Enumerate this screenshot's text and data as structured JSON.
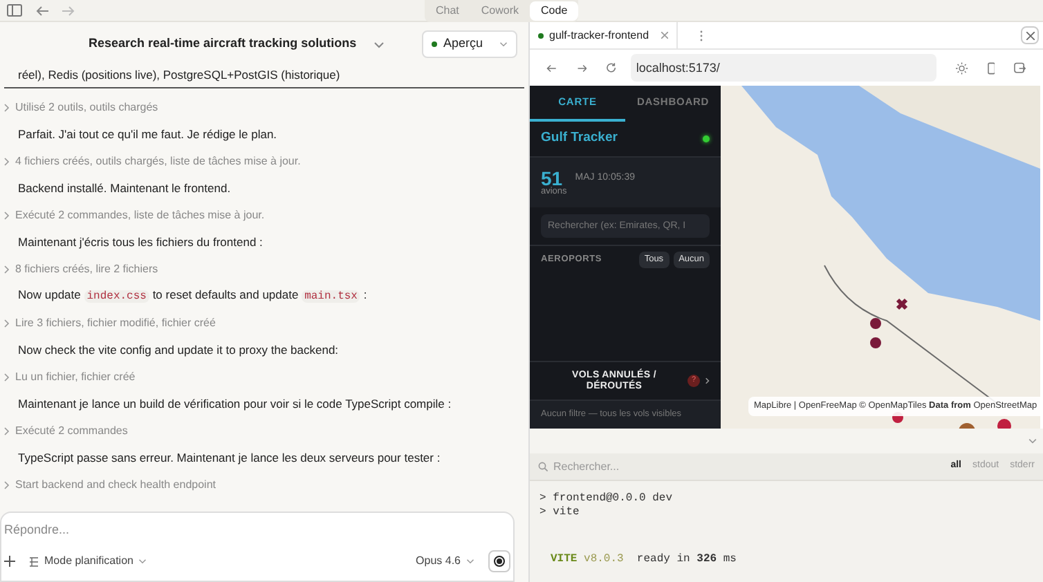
{
  "topbar": {
    "modes": [
      {
        "label": "Chat",
        "selected": false
      },
      {
        "label": "Cowork",
        "selected": false
      },
      {
        "label": "Code",
        "selected": true
      }
    ]
  },
  "chat": {
    "title": "Research real-time aircraft tracking solutions",
    "preview_button": "Aperçu",
    "messages": [
      {
        "kind": "tail",
        "parts": [
          {
            "kind": "plain",
            "text": "réel), Redis (positions live), PostgreSQL+PostGIS (historique)"
          }
        ]
      },
      {
        "kind": "tool",
        "parts": [
          {
            "kind": "plain",
            "text": "Utilisé 2 outils, outils chargés"
          }
        ]
      },
      {
        "kind": "text",
        "parts": [
          {
            "kind": "plain",
            "text": "Parfait. J'ai tout ce qu'il me faut. Je rédige le plan."
          }
        ]
      },
      {
        "kind": "tool",
        "parts": [
          {
            "kind": "plain",
            "text": "4 fichiers créés, outils chargés, liste de tâches mise à jour."
          }
        ]
      },
      {
        "kind": "text",
        "parts": [
          {
            "kind": "plain",
            "text": "Backend installé. Maintenant le frontend."
          }
        ]
      },
      {
        "kind": "tool",
        "parts": [
          {
            "kind": "plain",
            "text": "Exécuté 2 commandes, liste de tâches mise à jour."
          }
        ]
      },
      {
        "kind": "text",
        "parts": [
          {
            "kind": "plain",
            "text": "Maintenant j'écris tous les fichiers du frontend :"
          }
        ]
      },
      {
        "kind": "tool",
        "parts": [
          {
            "kind": "plain",
            "text": "8 fichiers créés, lire 2 fichiers"
          }
        ]
      },
      {
        "kind": "text",
        "parts": [
          {
            "kind": "plain",
            "text": "Now update "
          },
          {
            "kind": "code",
            "text": "index.css"
          },
          {
            "kind": "plain",
            "text": " to reset defaults and update "
          },
          {
            "kind": "code",
            "text": "main.tsx"
          },
          {
            "kind": "plain",
            "text": " :"
          }
        ]
      },
      {
        "kind": "tool",
        "parts": [
          {
            "kind": "plain",
            "text": "Lire 3 fichiers, fichier modifié, fichier créé"
          }
        ]
      },
      {
        "kind": "text",
        "parts": [
          {
            "kind": "plain",
            "text": "Now check the vite config and update it to proxy the backend:"
          }
        ]
      },
      {
        "kind": "tool",
        "parts": [
          {
            "kind": "plain",
            "text": "Lu un fichier, fichier créé"
          }
        ]
      },
      {
        "kind": "text",
        "parts": [
          {
            "kind": "plain",
            "text": "Maintenant je lance un build de vérification pour voir si le code TypeScript compile :"
          }
        ]
      },
      {
        "kind": "tool",
        "parts": [
          {
            "kind": "plain",
            "text": "Exécuté 2 commandes"
          }
        ]
      },
      {
        "kind": "text",
        "parts": [
          {
            "kind": "plain",
            "text": "TypeScript passe sans erreur. Maintenant je lance les deux serveurs pour tester :"
          }
        ]
      },
      {
        "kind": "tool",
        "parts": [
          {
            "kind": "plain",
            "text": "Start backend and check health endpoint"
          }
        ]
      }
    ],
    "composer": {
      "placeholder": "Répondre...",
      "mode": "Mode planification",
      "model": "Opus 4.6"
    }
  },
  "preview": {
    "tab_title": "gulf-tracker-frontend",
    "url": "localhost:5173/",
    "app": {
      "tabs": [
        {
          "label": "CARTE",
          "selected": true
        },
        {
          "label": "DASHBOARD",
          "selected": false
        }
      ],
      "title": "Gulf Tracker",
      "connected": true,
      "count": "51",
      "count_label": "avions",
      "updated": "MAJ 10:05:39",
      "search_placeholder": "Rechercher (ex: Emirates, QR, I",
      "airports_label": "AEROPORTS",
      "airport_buttons": [
        "Tous",
        "Aucun"
      ],
      "cancelled_label": "VOLS ANNULÉS / DÉROUTÉS",
      "cancelled_count": "?",
      "filter_note": "Aucun filtre — tous les vols visibles"
    },
    "map_attribution": "MapLibre | OpenFreeMap © OpenMapTiles **Data from** OpenStreetMap"
  },
  "terminal": {
    "search_placeholder": "Rechercher...",
    "filters": [
      {
        "label": "all",
        "selected": true
      },
      {
        "label": "stdout",
        "selected": false
      },
      {
        "label": "stderr",
        "selected": false
      }
    ],
    "lines": [
      {
        "kind": "plain",
        "text": "> frontend@0.0.0 dev"
      },
      {
        "kind": "plain",
        "text": "> vite"
      },
      {
        "kind": "blank"
      },
      {
        "kind": "vite",
        "name": "VITE",
        "version": "v8.0.3",
        "text": "ready in **326** ms"
      }
    ]
  }
}
